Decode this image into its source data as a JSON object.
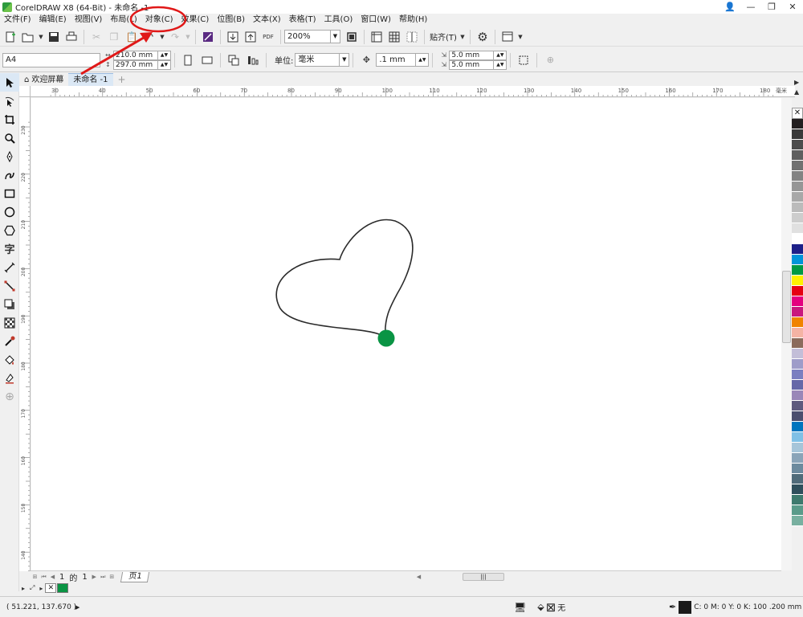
{
  "window": {
    "title": "CorelDRAW X8 (64-Bit) - 未命名 -1",
    "controls": [
      "👤",
      "—",
      "❐",
      "✕"
    ]
  },
  "menu": [
    "文件(F)",
    "编辑(E)",
    "视图(V)",
    "布局(L)",
    "对象(C)",
    "效果(C)",
    "位图(B)",
    "文本(X)",
    "表格(T)",
    "工具(O)",
    "窗口(W)",
    "帮助(H)"
  ],
  "toolbar": {
    "zoom": "200%",
    "snap_label": "贴齐(T)",
    "pdf_label": "PDF"
  },
  "property_bar": {
    "page_size": "A4",
    "width": "210.0 mm",
    "height": "297.0 mm",
    "unit_label": "单位:",
    "unit": "毫米",
    "nudge": ".1 mm",
    "dup_x": "5.0 mm",
    "dup_y": "5.0 mm"
  },
  "tabs": {
    "welcome": "欢迎屏幕",
    "document": "未命名 -1"
  },
  "ruler": {
    "h_ticks": [
      "30",
      "40",
      "50",
      "60",
      "70",
      "80",
      "90",
      "100",
      "110",
      "120",
      "130",
      "140",
      "150",
      "160",
      "170",
      "180"
    ],
    "h_unit": "毫米",
    "v_ticks": [
      "230",
      "220",
      "210",
      "200",
      "190",
      "180",
      "170",
      "160",
      "150",
      "140"
    ]
  },
  "page_nav": {
    "current": "1",
    "of_label": "的",
    "total": "1",
    "page_tab": "页1"
  },
  "status": {
    "coords": "( 51.221, 137.670 )",
    "fill_label": "无",
    "outline": "C: 0 M: 0 Y: 0 K: 100  .200 mm"
  },
  "colors": {
    "heart_stroke": "#2b2b2b",
    "node": "#0a9444",
    "annotation": "#e01818",
    "doc_swatch": "#0a9444"
  },
  "palette": [
    "#231f20",
    "#3a3a3a",
    "#4d4d4d",
    "#5f5f5f",
    "#717171",
    "#838383",
    "#969696",
    "#a8a8a8",
    "#bbbbbb",
    "#cdcdcd",
    "#e0e0e0",
    "#ffffff",
    "#1d2088",
    "#0095d9",
    "#009944",
    "#fff100",
    "#e60012",
    "#e4007f",
    "#c9177e",
    "#f08300",
    "#f4b3a4",
    "#8b6b5c",
    "#c3bed8",
    "#9e9cc9",
    "#7b7fc0",
    "#6668a8",
    "#9a87b8",
    "#5e5a7e",
    "#4b4e6e",
    "#0075be",
    "#7fc0e6",
    "#a6c5d9",
    "#8aa4b8",
    "#6c8a9e",
    "#506b7a",
    "#2f4f5c",
    "#3e7a6e",
    "#5a9b8a",
    "#78b0a0"
  ]
}
